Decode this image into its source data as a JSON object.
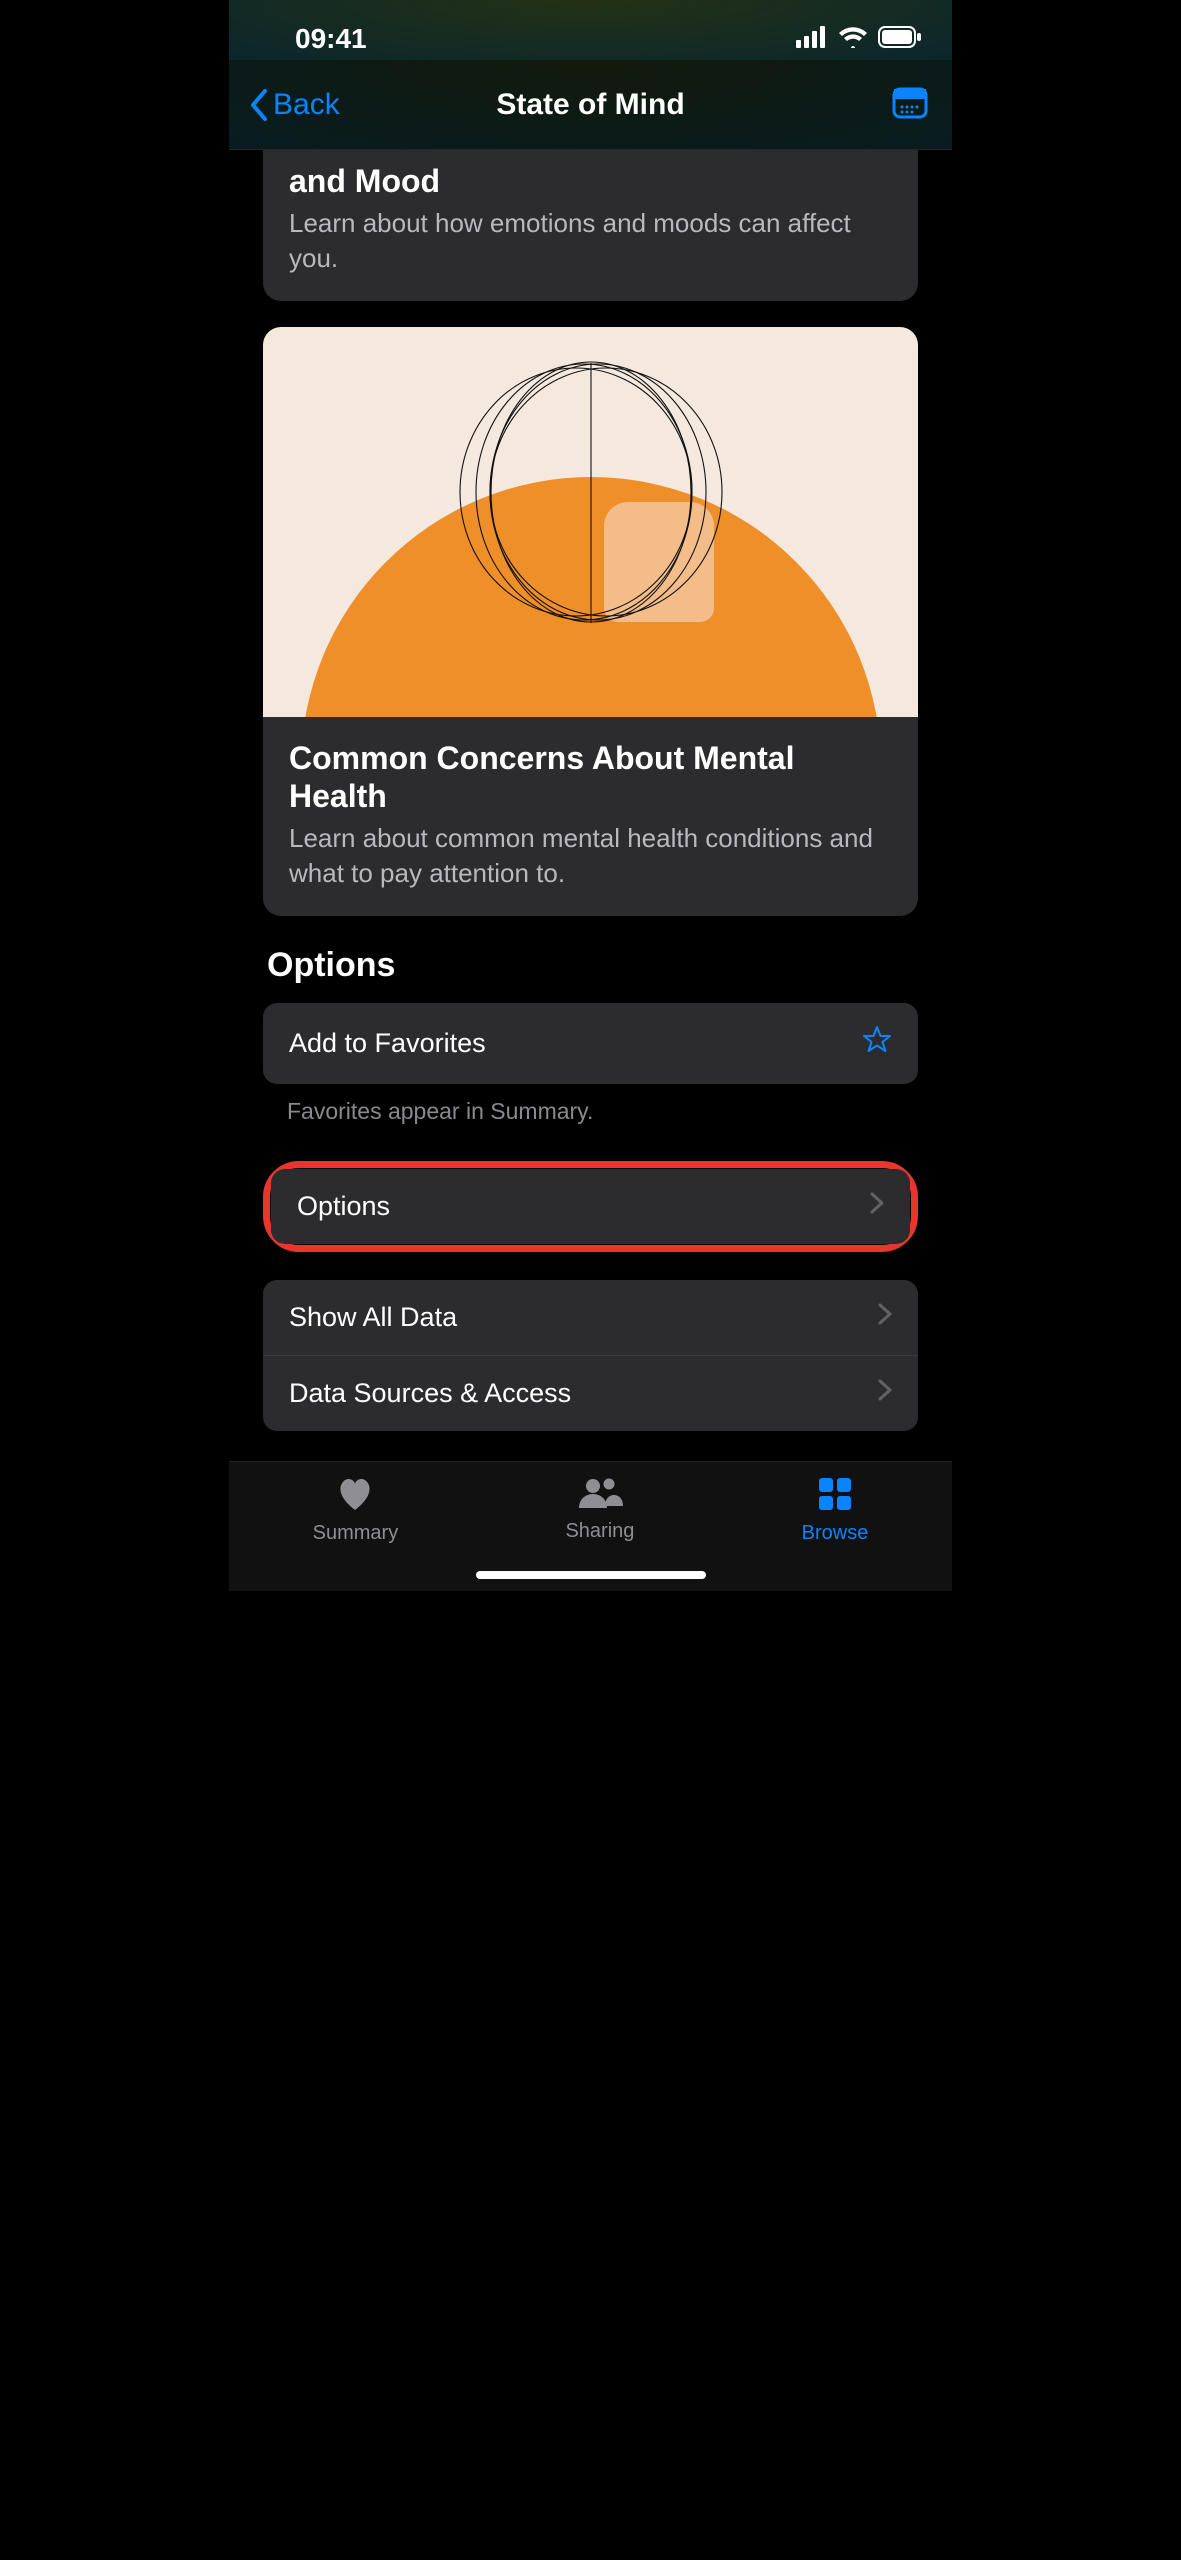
{
  "status": {
    "time": "09:41"
  },
  "nav": {
    "back": "Back",
    "title": "State of Mind"
  },
  "cards": [
    {
      "title": "and Mood",
      "subtitle": "Learn about how emotions and moods can affect you."
    },
    {
      "title": "Common Concerns About Mental Health",
      "subtitle": "Learn about common mental health conditions and what to pay attention to."
    }
  ],
  "options": {
    "heading": "Options",
    "favorites": "Add to Favorites",
    "favorites_note": "Favorites appear in Summary.",
    "options_row": "Options",
    "show_all": "Show All Data",
    "sources": "Data Sources & Access"
  },
  "tabs": {
    "summary": "Summary",
    "sharing": "Sharing",
    "browse": "Browse"
  }
}
